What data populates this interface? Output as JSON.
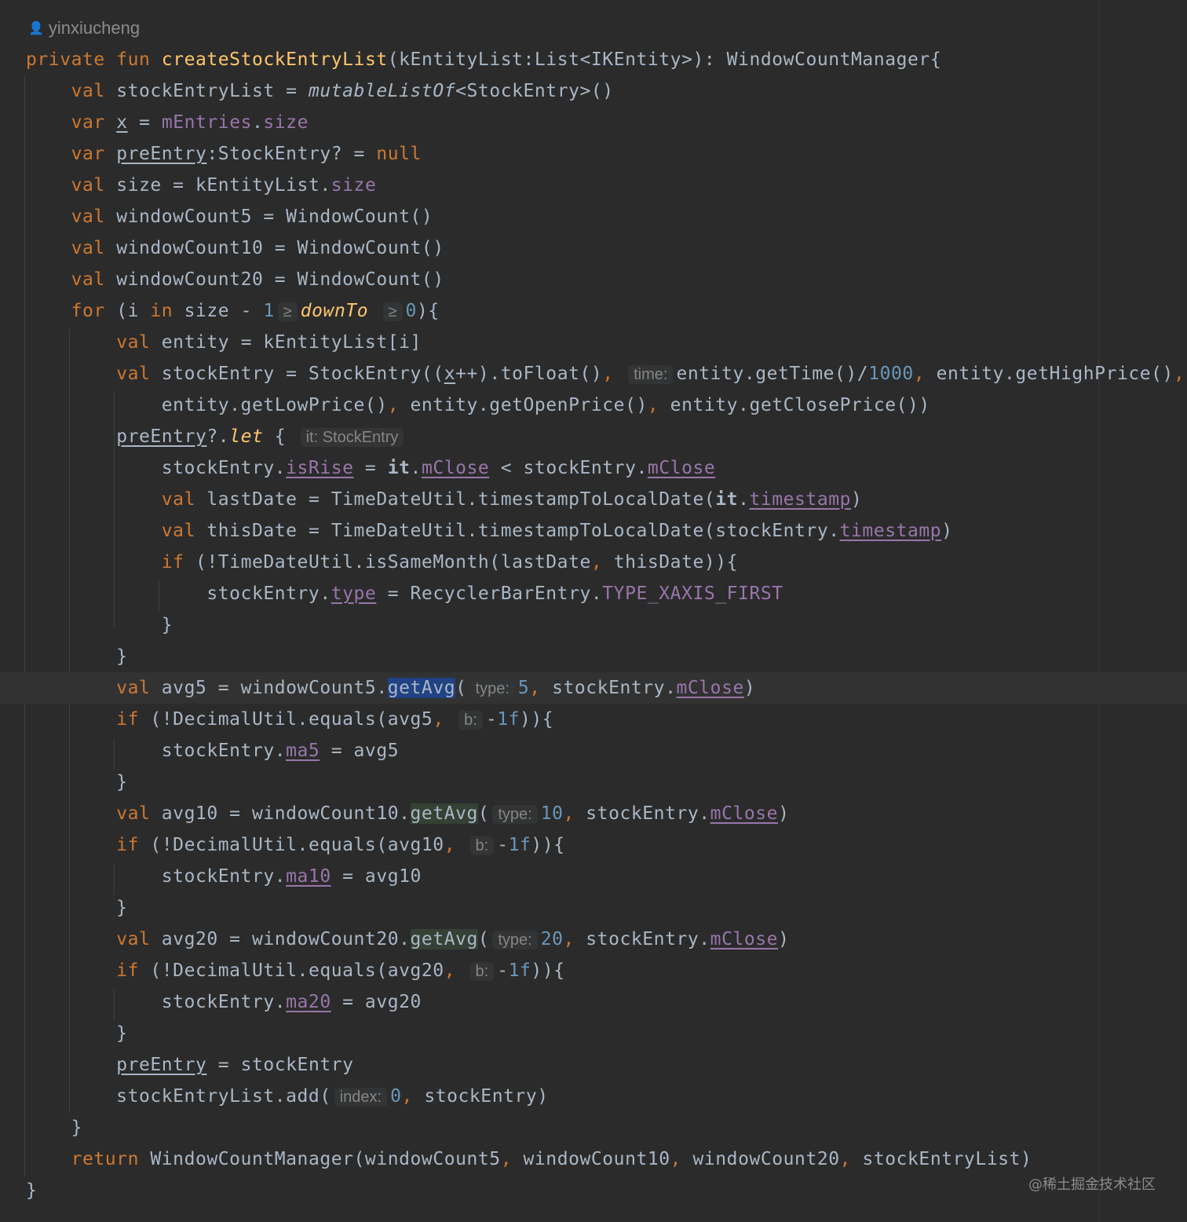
{
  "author": "yinxiucheng",
  "author_icon": "person-icon",
  "watermark": "@稀土掘金技术社区",
  "colors": {
    "background": "#2b2b2b",
    "keyword": "#cc7832",
    "function_decl": "#ffc66d",
    "field": "#9876aa",
    "number": "#6897bb",
    "text": "#a9b7c6",
    "hint": "#868686",
    "selection": "#214283"
  },
  "code": [
    [
      {
        "t": "private",
        "c": "k"
      },
      {
        "t": " "
      },
      {
        "t": "fun",
        "c": "k"
      },
      {
        "t": " "
      },
      {
        "t": "createStockEntryList",
        "c": "fn"
      },
      {
        "t": "(kEntityList:List<IKEntity>): WindowCountManager{"
      }
    ],
    [
      {
        "t": "    "
      },
      {
        "t": "val",
        "c": "k"
      },
      {
        "t": " stockEntryList = "
      },
      {
        "t": "mutableListOf",
        "c": "it"
      },
      {
        "t": "<StockEntry>()"
      }
    ],
    [
      {
        "t": "    "
      },
      {
        "t": "var",
        "c": "k"
      },
      {
        "t": " "
      },
      {
        "t": "x",
        "c": "u"
      },
      {
        "t": " = "
      },
      {
        "t": "mEntries",
        "c": "fld"
      },
      {
        "t": "."
      },
      {
        "t": "size",
        "c": "fld"
      }
    ],
    [
      {
        "t": "    "
      },
      {
        "t": "var",
        "c": "k"
      },
      {
        "t": " "
      },
      {
        "t": "preEntry",
        "c": "u"
      },
      {
        "t": ":StockEntry? = "
      },
      {
        "t": "null",
        "c": "k"
      }
    ],
    [
      {
        "t": "    "
      },
      {
        "t": "val",
        "c": "k"
      },
      {
        "t": " size = kEntityList."
      },
      {
        "t": "size",
        "c": "fld"
      }
    ],
    [
      {
        "t": "    "
      },
      {
        "t": "val",
        "c": "k"
      },
      {
        "t": " windowCount5 = WindowCount()"
      }
    ],
    [
      {
        "t": "    "
      },
      {
        "t": "val",
        "c": "k"
      },
      {
        "t": " windowCount10 = WindowCount()"
      }
    ],
    [
      {
        "t": "    "
      },
      {
        "t": "val",
        "c": "k"
      },
      {
        "t": " windowCount20 = WindowCount()"
      }
    ],
    [
      {
        "t": "    "
      },
      {
        "t": "for",
        "c": "k"
      },
      {
        "t": " (i "
      },
      {
        "t": "in",
        "c": "k"
      },
      {
        "t": " size - "
      },
      {
        "t": "1",
        "c": "num"
      },
      {
        "t": "≥",
        "c": "hint"
      },
      {
        "t": "downTo",
        "c": "fn it"
      },
      {
        "t": " "
      },
      {
        "t": "≥",
        "c": "hint"
      },
      {
        "t": "0",
        "c": "num"
      },
      {
        "t": "){"
      }
    ],
    [
      {
        "t": "        "
      },
      {
        "t": "val",
        "c": "k"
      },
      {
        "t": " entity = kEntityList[i]"
      }
    ],
    [
      {
        "t": "        "
      },
      {
        "t": "val",
        "c": "k"
      },
      {
        "t": " stockEntry = StockEntry(("
      },
      {
        "t": "x",
        "c": "u"
      },
      {
        "t": "++).toFloat()"
      },
      {
        "t": ",",
        "c": "k"
      },
      {
        "t": " "
      },
      {
        "t": "time:",
        "c": "hint"
      },
      {
        "t": "entity.getTime()/"
      },
      {
        "t": "1000",
        "c": "num"
      },
      {
        "t": ",",
        "c": "k"
      },
      {
        "t": " entity.getHighPrice()"
      },
      {
        "t": ",",
        "c": "k"
      }
    ],
    [
      {
        "t": "            entity.getLowPrice()"
      },
      {
        "t": ",",
        "c": "k"
      },
      {
        "t": " entity.getOpenPrice()"
      },
      {
        "t": ",",
        "c": "k"
      },
      {
        "t": " entity.getClosePrice())"
      }
    ],
    [
      {
        "t": "        "
      },
      {
        "t": "preEntry",
        "c": "u"
      },
      {
        "t": "?."
      },
      {
        "t": "let",
        "c": "fn it"
      },
      {
        "t": " { "
      },
      {
        "t": "it: StockEntry",
        "c": "hint"
      }
    ],
    [
      {
        "t": "            stockEntry."
      },
      {
        "t": "isRise",
        "c": "fld u"
      },
      {
        "t": " = "
      },
      {
        "t": "it",
        "c": "b"
      },
      {
        "t": "."
      },
      {
        "t": "mClose",
        "c": "fld u"
      },
      {
        "t": " < stockEntry."
      },
      {
        "t": "mClose",
        "c": "fld u"
      }
    ],
    [
      {
        "t": "            "
      },
      {
        "t": "val",
        "c": "k"
      },
      {
        "t": " lastDate = TimeDateUtil.timestampToLocalDate("
      },
      {
        "t": "it",
        "c": "b"
      },
      {
        "t": "."
      },
      {
        "t": "timestamp",
        "c": "fld u"
      },
      {
        "t": ")"
      }
    ],
    [
      {
        "t": "            "
      },
      {
        "t": "val",
        "c": "k"
      },
      {
        "t": " thisDate = TimeDateUtil.timestampToLocalDate(stockEntry."
      },
      {
        "t": "timestamp",
        "c": "fld u"
      },
      {
        "t": ")"
      }
    ],
    [
      {
        "t": "            "
      },
      {
        "t": "if",
        "c": "k"
      },
      {
        "t": " (!TimeDateUtil.isSameMonth(lastDate"
      },
      {
        "t": ",",
        "c": "k"
      },
      {
        "t": " thisDate)){"
      }
    ],
    [
      {
        "t": "                stockEntry."
      },
      {
        "t": "type",
        "c": "fld u"
      },
      {
        "t": " = RecyclerBarEntry."
      },
      {
        "t": "TYPE_XAXIS_FIRST",
        "c": "fld"
      }
    ],
    [
      {
        "t": "            }"
      }
    ],
    [
      {
        "t": "        }"
      }
    ],
    [
      {
        "t": "        "
      },
      {
        "t": "val",
        "c": "k"
      },
      {
        "t": " avg5 = windowCount5."
      },
      {
        "t": "getAvg",
        "c": "sel"
      },
      {
        "t": "("
      },
      {
        "t": "type:",
        "c": "hint"
      },
      {
        "t": "5",
        "c": "num"
      },
      {
        "t": ",",
        "c": "k"
      },
      {
        "t": " stockEntry."
      },
      {
        "t": "mClose",
        "c": "fld u"
      },
      {
        "t": ")"
      }
    ],
    [
      {
        "t": "        "
      },
      {
        "t": "if",
        "c": "k"
      },
      {
        "t": " (!DecimalUtil.equals(avg5"
      },
      {
        "t": ",",
        "c": "k"
      },
      {
        "t": " "
      },
      {
        "t": "b:",
        "c": "hint"
      },
      {
        "t": "-"
      },
      {
        "t": "1f",
        "c": "num"
      },
      {
        "t": ")){"
      }
    ],
    [
      {
        "t": "            stockEntry."
      },
      {
        "t": "ma5",
        "c": "fld u"
      },
      {
        "t": " = avg5"
      }
    ],
    [
      {
        "t": "        }"
      }
    ],
    [
      {
        "t": "        "
      },
      {
        "t": "val",
        "c": "k"
      },
      {
        "t": " avg10 = windowCount10."
      },
      {
        "t": "getAvg",
        "c": "match"
      },
      {
        "t": "("
      },
      {
        "t": "type:",
        "c": "hint"
      },
      {
        "t": "10",
        "c": "num"
      },
      {
        "t": ",",
        "c": "k"
      },
      {
        "t": " stockEntry."
      },
      {
        "t": "mClose",
        "c": "fld u"
      },
      {
        "t": ")"
      }
    ],
    [
      {
        "t": "        "
      },
      {
        "t": "if",
        "c": "k"
      },
      {
        "t": " (!DecimalUtil.equals(avg10"
      },
      {
        "t": ",",
        "c": "k"
      },
      {
        "t": " "
      },
      {
        "t": "b:",
        "c": "hint"
      },
      {
        "t": "-"
      },
      {
        "t": "1f",
        "c": "num"
      },
      {
        "t": ")){"
      }
    ],
    [
      {
        "t": "            stockEntry."
      },
      {
        "t": "ma10",
        "c": "fld u"
      },
      {
        "t": " = avg10"
      }
    ],
    [
      {
        "t": "        }"
      }
    ],
    [
      {
        "t": "        "
      },
      {
        "t": "val",
        "c": "k"
      },
      {
        "t": " avg20 = windowCount20."
      },
      {
        "t": "getAvg",
        "c": "match"
      },
      {
        "t": "("
      },
      {
        "t": "type:",
        "c": "hint"
      },
      {
        "t": "20",
        "c": "num"
      },
      {
        "t": ",",
        "c": "k"
      },
      {
        "t": " stockEntry."
      },
      {
        "t": "mClose",
        "c": "fld u"
      },
      {
        "t": ")"
      }
    ],
    [
      {
        "t": "        "
      },
      {
        "t": "if",
        "c": "k"
      },
      {
        "t": " (!DecimalUtil.equals(avg20"
      },
      {
        "t": ",",
        "c": "k"
      },
      {
        "t": " "
      },
      {
        "t": "b:",
        "c": "hint"
      },
      {
        "t": "-"
      },
      {
        "t": "1f",
        "c": "num"
      },
      {
        "t": ")){"
      }
    ],
    [
      {
        "t": "            stockEntry."
      },
      {
        "t": "ma20",
        "c": "fld u"
      },
      {
        "t": " = avg20"
      }
    ],
    [
      {
        "t": "        }"
      }
    ],
    [
      {
        "t": "        "
      },
      {
        "t": "preEntry",
        "c": "u"
      },
      {
        "t": " = stockEntry"
      }
    ],
    [
      {
        "t": "        stockEntryList.add("
      },
      {
        "t": "index:",
        "c": "hint"
      },
      {
        "t": "0",
        "c": "num"
      },
      {
        "t": ",",
        "c": "k"
      },
      {
        "t": " stockEntry)"
      }
    ],
    [
      {
        "t": "    }"
      }
    ],
    [
      {
        "t": "    "
      },
      {
        "t": "return",
        "c": "k"
      },
      {
        "t": " WindowCountManager(windowCount5"
      },
      {
        "t": ",",
        "c": "k"
      },
      {
        "t": " windowCount10"
      },
      {
        "t": ",",
        "c": "k"
      },
      {
        "t": " windowCount20"
      },
      {
        "t": ",",
        "c": "k"
      },
      {
        "t": " stockEntryList)"
      }
    ],
    [
      {
        "t": "}"
      }
    ]
  ]
}
